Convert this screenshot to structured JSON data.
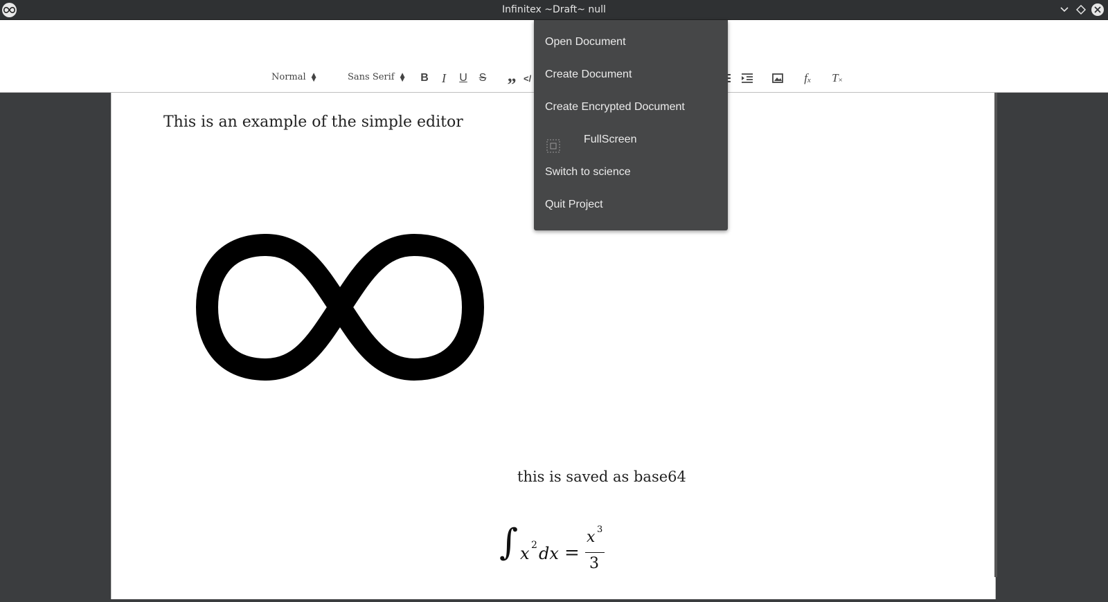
{
  "window": {
    "title": "Infinitex ~Draft~ null"
  },
  "toolbar": {
    "header_select": "Normal",
    "font_select": "Sans Serif",
    "bold": "B",
    "italic": "I",
    "underline": "U",
    "strike": "S",
    "blockquote": "”",
    "code": "</",
    "icons": [
      "bold-icon",
      "italic-icon",
      "underline-icon",
      "strike-icon",
      "blockquote-icon",
      "code-icon",
      "list-icon",
      "indent-icon",
      "image-icon",
      "formula-icon",
      "clear-format-icon"
    ]
  },
  "menu": {
    "items": [
      {
        "label": "Open Document"
      },
      {
        "label": "Create Document"
      },
      {
        "label": "Create Encrypted Document"
      },
      {
        "label": "FullScreen",
        "icon": "fullscreen-icon"
      },
      {
        "label": "Switch to science"
      },
      {
        "label": "Quit Project"
      }
    ]
  },
  "document": {
    "heading": "This is an example of the simple editor",
    "image": "infinity-symbol",
    "caption": "this is saved as base64",
    "formula": {
      "integral": "∫",
      "lhs_base": "x",
      "lhs_exp": "2",
      "lhs_diff": "dx",
      "equals": "=",
      "num_base": "x",
      "num_exp": "3",
      "den": "3"
    }
  },
  "colors": {
    "titlebar": "#2f3133",
    "menu_bg": "#464748",
    "background": "#3b3d3f"
  }
}
